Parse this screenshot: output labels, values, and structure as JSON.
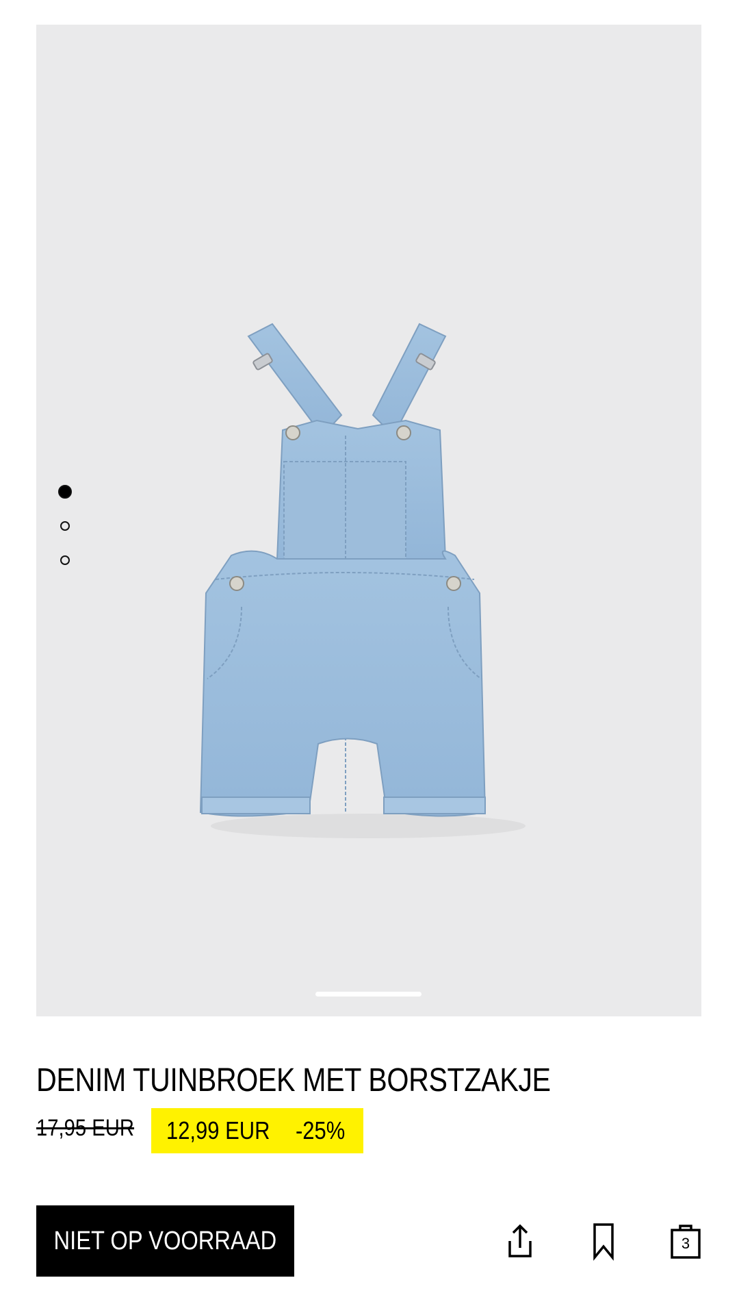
{
  "product": {
    "title": "DENIM TUINBROEK MET BORSTZAKJE",
    "old_price": "17,95 EUR",
    "sale_price": "12,99 EUR",
    "discount": "-25%"
  },
  "gallery": {
    "image_count": 3,
    "active_index": 0
  },
  "actions": {
    "stock_label": "NIET OP VOORRAAD",
    "share_icon": "share-icon",
    "bookmark_icon": "bookmark-icon",
    "bag_icon": "shopping-bag-icon",
    "bag_count": "3"
  },
  "colors": {
    "sale_highlight": "#fff200",
    "button_background": "#000000",
    "image_background": "#eaeaeb",
    "denim": "#9fbfdc"
  }
}
